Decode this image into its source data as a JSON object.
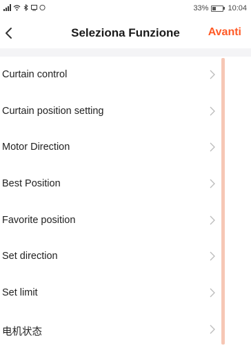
{
  "status_bar": {
    "battery_percent": "33%",
    "battery_level": 0.33,
    "time": "10:04"
  },
  "nav": {
    "title": "Seleziona Funzione",
    "next_label": "Avanti",
    "accent_color": "#ff5a26"
  },
  "functions": [
    {
      "label": "Curtain control"
    },
    {
      "label": "Curtain position setting"
    },
    {
      "label": "Motor Direction"
    },
    {
      "label": "Best Position"
    },
    {
      "label": "Favorite position"
    },
    {
      "label": "Set direction"
    },
    {
      "label": "Set limit"
    },
    {
      "label": "电机状态"
    }
  ]
}
